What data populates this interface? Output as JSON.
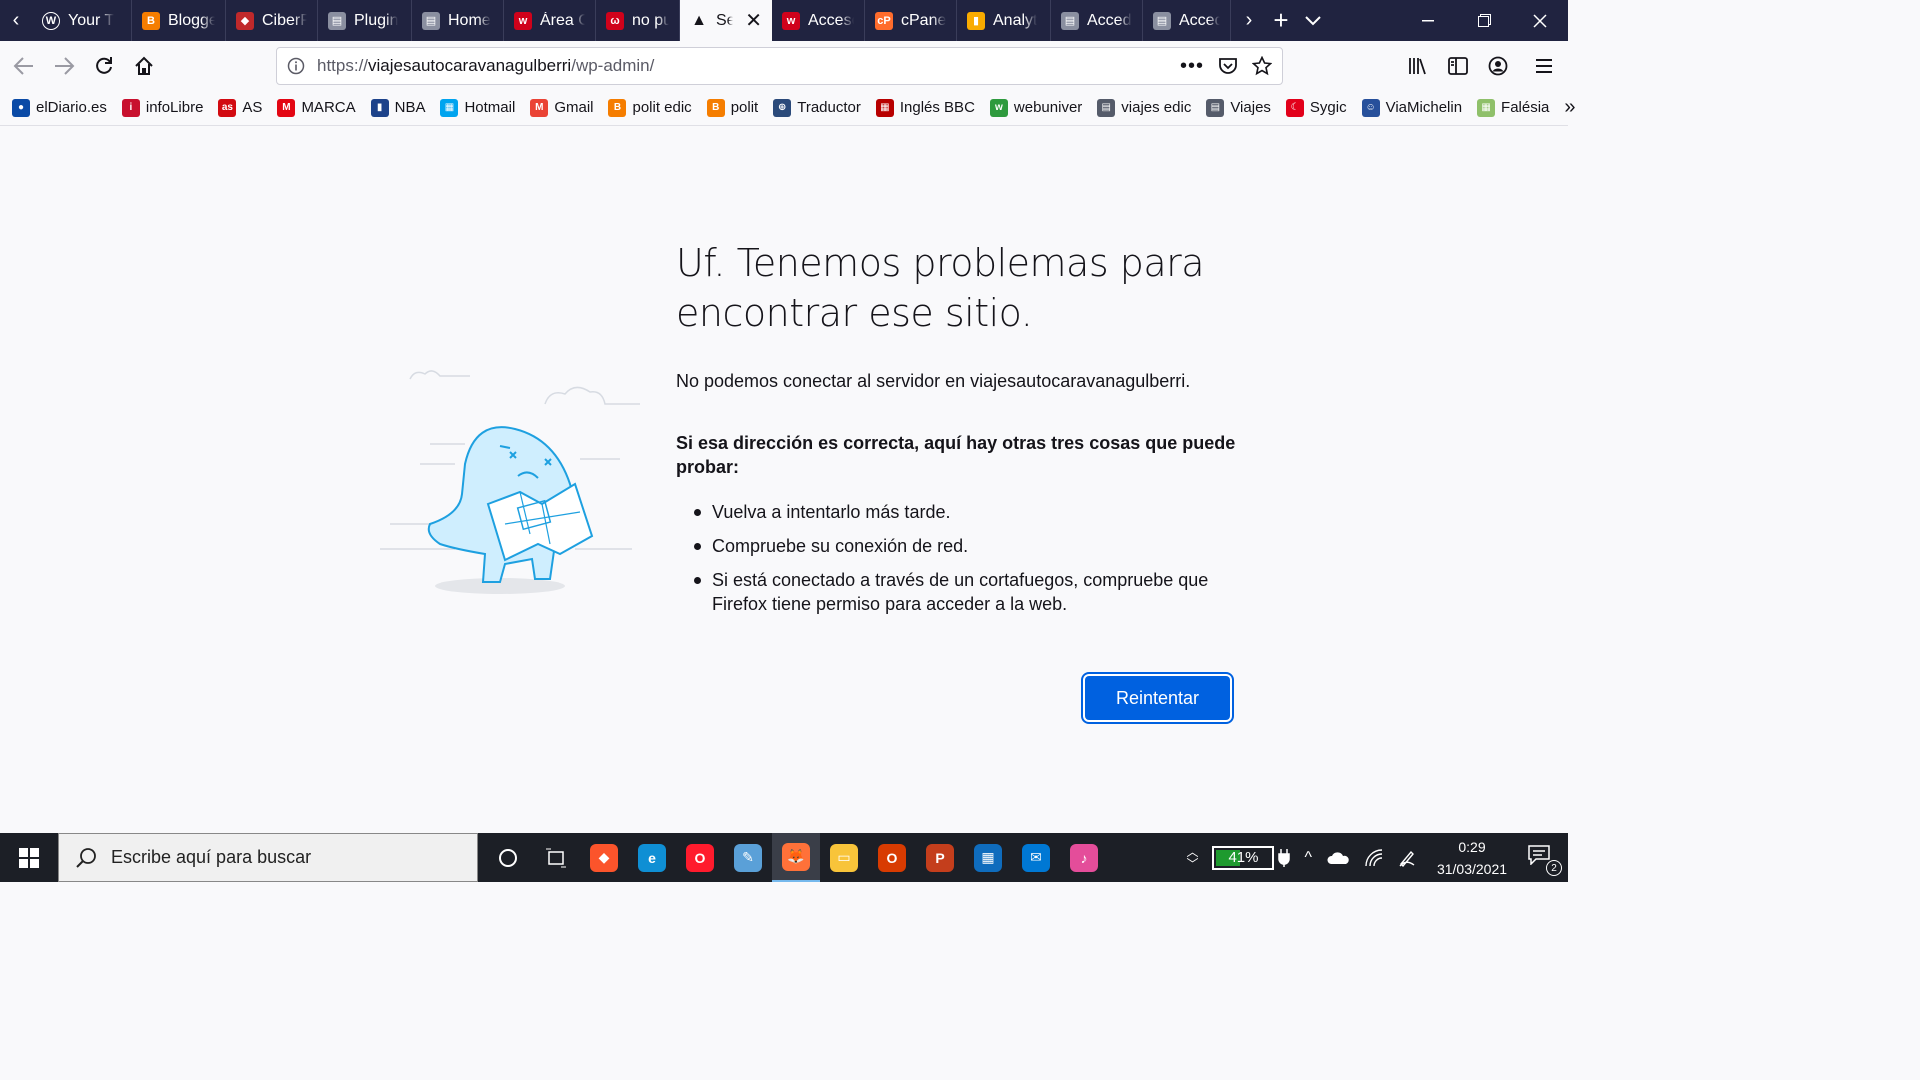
{
  "browser": {
    "tabs": [
      {
        "title": "Your T",
        "icon": "wordpress-icon",
        "color": "#ffffff",
        "glyph": "W",
        "active": false,
        "width": 100
      },
      {
        "title": "Blogge",
        "icon": "blogger-icon",
        "color": "#f57d00",
        "glyph": "B",
        "active": false,
        "width": 94
      },
      {
        "title": "CiberP",
        "icon": "brave-shield-icon",
        "color": "#c0292b",
        "glyph": "◆",
        "active": false,
        "width": 92
      },
      {
        "title": "Plugin",
        "icon": "page-icon",
        "color": "#8a8fa0",
        "glyph": "▤",
        "active": false,
        "width": 94
      },
      {
        "title": "Home",
        "icon": "page-icon",
        "color": "#8a8fa0",
        "glyph": "▤",
        "active": false,
        "width": 92
      },
      {
        "title": "Área C",
        "icon": "webempresa-icon",
        "color": "#d0021b",
        "glyph": "w",
        "active": false,
        "width": 92
      },
      {
        "title": "no puc",
        "icon": "webempresa-icon",
        "color": "#d0021b",
        "glyph": "ω",
        "active": false,
        "width": 84
      },
      {
        "title": "Ser",
        "icon": "warning-icon",
        "color": "#15141a",
        "glyph": "▲",
        "active": true,
        "width": 92
      },
      {
        "title": "Acceso",
        "icon": "webempresa-icon",
        "color": "#d0021b",
        "glyph": "w",
        "active": false,
        "width": 93
      },
      {
        "title": "cPanel",
        "icon": "cpanel-icon",
        "color": "#ff6c2c",
        "glyph": "cP",
        "active": false,
        "width": 92
      },
      {
        "title": "Analyt",
        "icon": "analytics-icon",
        "color": "#f9ab00",
        "glyph": "▮",
        "active": false,
        "width": 94
      },
      {
        "title": "Accede",
        "icon": "page-icon",
        "color": "#8a8fa0",
        "glyph": "▤",
        "active": false,
        "width": 92
      },
      {
        "title": "Accede",
        "icon": "page-icon",
        "color": "#8a8fa0",
        "glyph": "▤",
        "active": false,
        "width": 88
      }
    ],
    "url": {
      "prefix": "https://",
      "host": "viajesautocaravanagulberri",
      "path": "/wp-admin/"
    },
    "bookmarks": [
      {
        "label": "elDiario.es",
        "icon": "eldiario-icon",
        "color": "#0a4aa6",
        "glyph": "●"
      },
      {
        "label": "infoLibre",
        "icon": "infolibre-icon",
        "color": "#c8102e",
        "glyph": "i"
      },
      {
        "label": "AS",
        "icon": "as-icon",
        "color": "#d20a11",
        "glyph": "as"
      },
      {
        "label": "MARCA",
        "icon": "marca-icon",
        "color": "#e30613",
        "glyph": "M"
      },
      {
        "label": "NBA",
        "icon": "nba-icon",
        "color": "#1d428a",
        "glyph": "▮"
      },
      {
        "label": "Hotmail",
        "icon": "microsoft-icon",
        "color": "#00a4ef",
        "glyph": "▦"
      },
      {
        "label": "Gmail",
        "icon": "gmail-icon",
        "color": "#ea4335",
        "glyph": "M"
      },
      {
        "label": "polit edic",
        "icon": "blogger-icon",
        "color": "#f57d00",
        "glyph": "B"
      },
      {
        "label": "polit",
        "icon": "blogger-icon",
        "color": "#f57d00",
        "glyph": "B"
      },
      {
        "label": "Traductor",
        "icon": "globe-icon",
        "color": "#2b4a7a",
        "glyph": "⊕"
      },
      {
        "label": "Inglés BBC",
        "icon": "bbc-icon",
        "color": "#b80000",
        "glyph": "▦"
      },
      {
        "label": "webuniver",
        "icon": "webuniver-icon",
        "color": "#2e9a3e",
        "glyph": "w"
      },
      {
        "label": "viajes edic",
        "icon": "page-icon",
        "color": "#555b6a",
        "glyph": "▤"
      },
      {
        "label": "Viajes",
        "icon": "page-icon",
        "color": "#555b6a",
        "glyph": "▤"
      },
      {
        "label": "Sygic",
        "icon": "sygic-icon",
        "color": "#e2001a",
        "glyph": "☾"
      },
      {
        "label": "ViaMichelin",
        "icon": "michelin-icon",
        "color": "#27509b",
        "glyph": "☺"
      },
      {
        "label": "Falésia",
        "icon": "map-icon",
        "color": "#8fc06a",
        "glyph": "▦"
      }
    ]
  },
  "error_page": {
    "title": "Uf. Tenemos problemas para encontrar ese sitio.",
    "description": "No podemos conectar al servidor en viajesautocaravanagulberri.",
    "suggestions_title": "Si esa dirección es correcta, aquí hay otras tres cosas que puede probar:",
    "suggestions": [
      "Vuelva a intentarlo más tarde.",
      "Compruebe su conexión de red.",
      "Si está conectado a través de un cortafuegos, compruebe que Firefox tiene permiso para acceder a la web."
    ],
    "retry_label": "Reintentar"
  },
  "taskbar": {
    "search_placeholder": "Escribe aquí para buscar",
    "apps": [
      {
        "name": "brave-app",
        "color": "#fb542b",
        "glyph": "◆"
      },
      {
        "name": "edge-app",
        "color": "#0f8fd4",
        "glyph": "e"
      },
      {
        "name": "opera-app",
        "color": "#ff1b2d",
        "glyph": "O"
      },
      {
        "name": "paint-app",
        "color": "#5aa0d8",
        "glyph": "✎"
      },
      {
        "name": "firefox-app",
        "color": "#ff7139",
        "glyph": "🦊",
        "active": true
      },
      {
        "name": "file-explorer-app",
        "color": "#f8c43a",
        "glyph": "▭"
      },
      {
        "name": "office-app",
        "color": "#d83b01",
        "glyph": "O"
      },
      {
        "name": "powerpoint-app",
        "color": "#c43e1c",
        "glyph": "P"
      },
      {
        "name": "store-app",
        "color": "#0f6cbd",
        "glyph": "▦"
      },
      {
        "name": "mail-app",
        "color": "#0078d4",
        "glyph": "✉"
      },
      {
        "name": "itunes-app",
        "color": "#e44d9a",
        "glyph": "♪"
      }
    ],
    "battery_percent": "41%",
    "battery_level": 0.41,
    "time": "0:29",
    "date": "31/03/2021",
    "notification_count": "2"
  }
}
